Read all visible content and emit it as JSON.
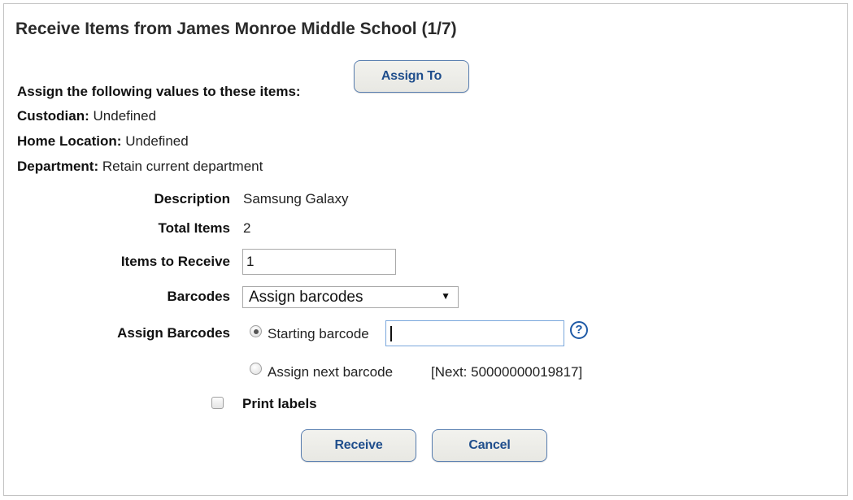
{
  "title": "Receive Items from James Monroe Middle School (1/7)",
  "assign_section": {
    "heading": "Assign the following values to these items:",
    "assign_to_label": "Assign To",
    "fields": [
      {
        "label": "Custodian:",
        "value": "Undefined"
      },
      {
        "label": "Home Location:",
        "value": "Undefined"
      },
      {
        "label": "Department:",
        "value": "Retain current department"
      }
    ]
  },
  "form": {
    "description_label": "Description",
    "description_value": "Samsung Galaxy",
    "total_items_label": "Total Items",
    "total_items_value": "2",
    "items_to_receive_label": "Items to Receive",
    "items_to_receive_value": "1",
    "barcodes_label": "Barcodes",
    "barcodes_selected": "Assign barcodes",
    "barcodes_arrow": "▼",
    "assign_barcodes_label": "Assign Barcodes",
    "starting_barcode_label": "Starting barcode",
    "starting_barcode_value": "",
    "starting_barcode_checked": true,
    "next_barcode_label": "Assign next barcode",
    "next_barcode_checked": false,
    "next_barcode_info": "[Next: 50000000019817]",
    "help_icon": "?",
    "print_labels_label": "Print labels",
    "print_labels_checked": false
  },
  "actions": {
    "receive_label": "Receive",
    "cancel_label": "Cancel"
  },
  "colors": {
    "button_text": "#1f4e8c",
    "button_border": "#5a7fb0",
    "help_icon": "#1f5aa6",
    "focus_border": "#7aa7dc"
  }
}
